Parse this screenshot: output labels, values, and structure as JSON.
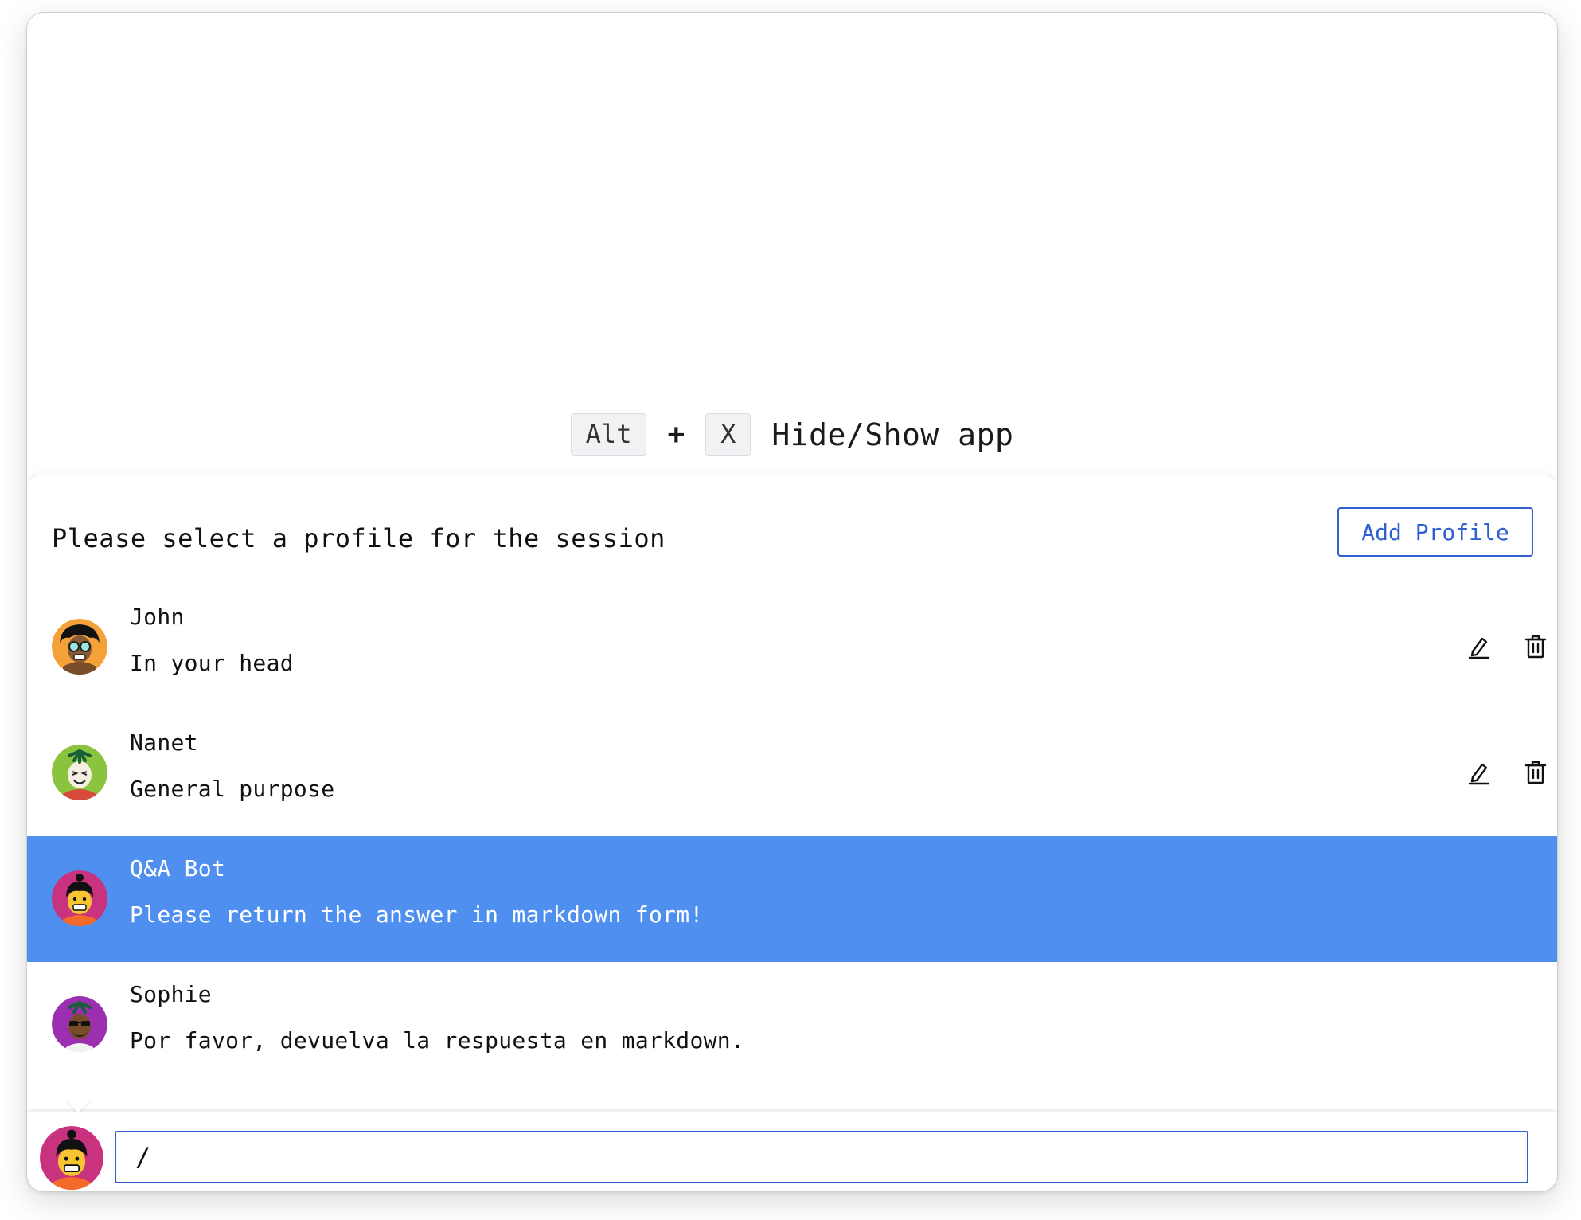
{
  "shortcut": {
    "key1": "Alt",
    "plus": "+",
    "key2": "X",
    "label": "Hide/Show app"
  },
  "profile_panel": {
    "title": "Please select a profile for the session",
    "add_button": "Add Profile",
    "profiles": [
      {
        "name": "John",
        "description": "In your head",
        "selected": false,
        "avatar": "avatar-afro-glasses-icon"
      },
      {
        "name": "Nanet",
        "description": "General purpose",
        "selected": false,
        "avatar": "avatar-green-smiling-icon"
      },
      {
        "name": "Q&A Bot",
        "description": "Please return the answer in markdown form!",
        "selected": true,
        "avatar": "avatar-pink-bun-icon"
      },
      {
        "name": "Sophie",
        "description": "Por favor, devuelva la respuesta en markdown.",
        "selected": false,
        "avatar": "avatar-purple-sunglasses-icon"
      }
    ]
  },
  "chat_input": {
    "value": "/",
    "avatar": "avatar-pink-bun-icon"
  },
  "colors": {
    "accent": "#2f5fd1",
    "selected_row": "#4f8ff0",
    "kbd_bg": "#f1f2f4"
  }
}
